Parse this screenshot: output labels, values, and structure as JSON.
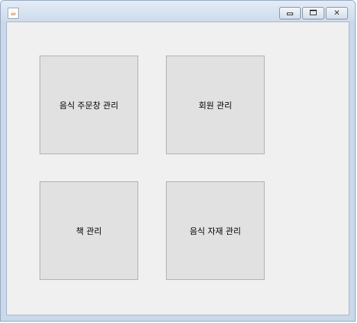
{
  "window": {
    "title": "",
    "icon": "java-icon"
  },
  "controls": {
    "minimize_icon": "minimize-icon",
    "maximize_icon": "maximize-icon",
    "close_icon": "close-icon",
    "close_glyph": "✕"
  },
  "buttons": [
    {
      "label": "음식 주문창 관리"
    },
    {
      "label": "회원 관리"
    },
    {
      "label": "책 관리"
    },
    {
      "label": "음식 자재 관리"
    }
  ]
}
